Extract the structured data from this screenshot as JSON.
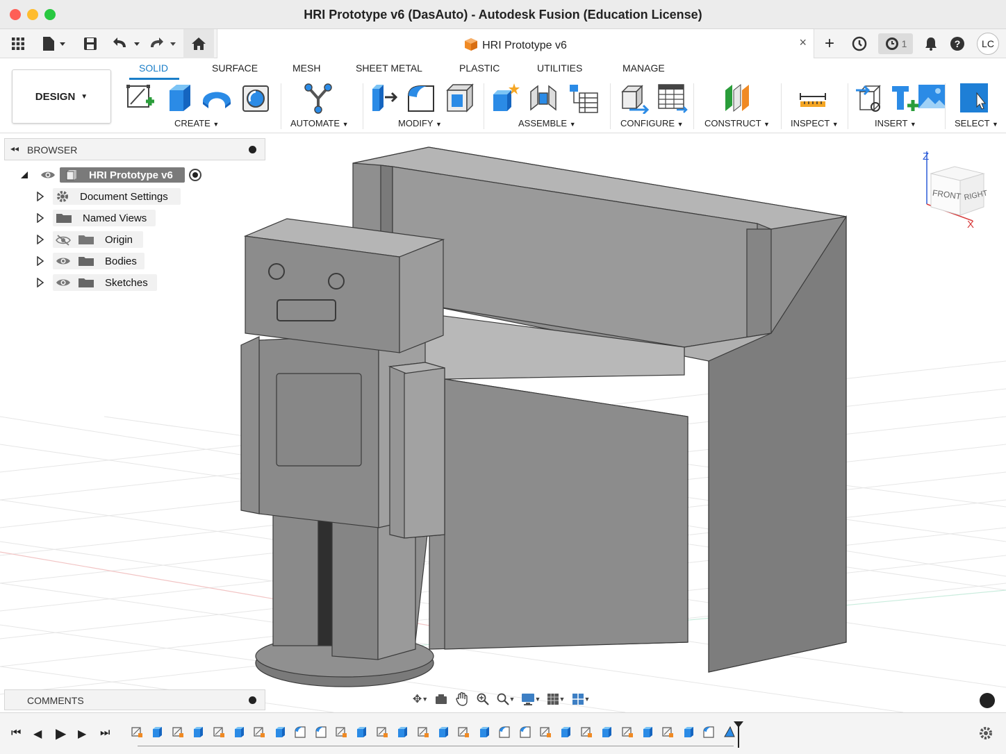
{
  "window": {
    "title": "HRI Prototype v6 (DasAuto) - Autodesk Fusion (Education License)"
  },
  "toolbar": {
    "doc_tab_title": "HRI Prototype v6",
    "close_glyph": "×",
    "add_glyph": "+",
    "jobs_count": "1",
    "user_initials": "LC"
  },
  "ribbon": {
    "workspace": "DESIGN",
    "tabs": [
      "SOLID",
      "SURFACE",
      "MESH",
      "SHEET METAL",
      "PLASTIC",
      "UTILITIES",
      "MANAGE"
    ],
    "active_tab": "SOLID",
    "groups": [
      "CREATE",
      "AUTOMATE",
      "MODIFY",
      "ASSEMBLE",
      "CONFIGURE",
      "CONSTRUCT",
      "INSPECT",
      "INSERT",
      "SELECT"
    ]
  },
  "browser": {
    "title": "BROWSER",
    "root": "HRI Prototype v6",
    "items": [
      {
        "label": "Document Settings",
        "icon": "gear-icon"
      },
      {
        "label": "Named Views",
        "icon": "folder-icon"
      },
      {
        "label": "Origin",
        "icon": "folder-icon",
        "hidden": true
      },
      {
        "label": "Bodies",
        "icon": "folder-icon"
      },
      {
        "label": "Sketches",
        "icon": "folder-icon"
      }
    ]
  },
  "comments": {
    "title": "COMMENTS"
  },
  "viewcube": {
    "front": "FRONT",
    "right": "RIGHT",
    "axis_z": "Z",
    "axis_x": "X"
  },
  "timeline": {
    "feature_count": 30
  },
  "colors": {
    "accent": "#1a7ec8",
    "model_grey": "#8f8f8f",
    "grid": "#e3e3e3"
  }
}
